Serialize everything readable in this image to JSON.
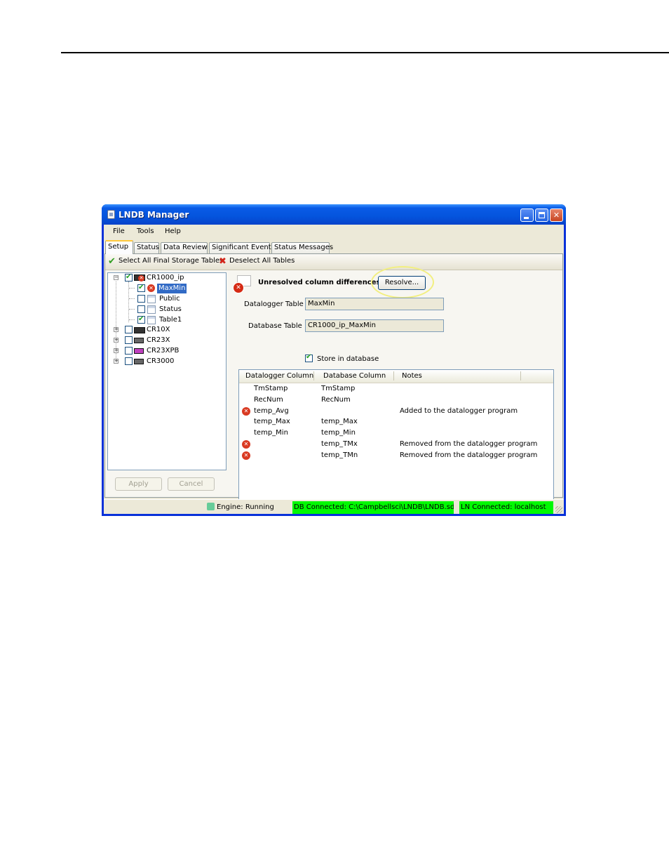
{
  "window": {
    "title": "LNDB Manager"
  },
  "menu": [
    "File",
    "Tools",
    "Help"
  ],
  "tabs": [
    "Setup",
    "Status",
    "Data Review",
    "Significant Events",
    "Status Messages"
  ],
  "toolbar": {
    "select_all": "Select All Final Storage Tables",
    "deselect_all": "Deselect All Tables"
  },
  "tree": {
    "root": "CR1000_ip",
    "tables": [
      "MaxMin",
      "Public",
      "Status",
      "Table1"
    ],
    "others": [
      "CR10X",
      "CR23X",
      "CR23XPB",
      "CR3000"
    ]
  },
  "buttons": {
    "apply": "Apply",
    "cancel": "Cancel",
    "resolve": "Resolve..."
  },
  "detail": {
    "warning": "Unresolved column differences",
    "datalogger_table_label": "Datalogger Table",
    "datalogger_table_value": "MaxMin",
    "database_table_label": "Database Table",
    "database_table_value": "CR1000_ip_MaxMin",
    "store_label": "Store in database"
  },
  "columns": {
    "headers": [
      "Datalogger Column",
      "Database Column",
      "Notes"
    ],
    "rows": [
      {
        "datalogger": "TmStamp",
        "database": "TmStamp",
        "notes": "",
        "error": false
      },
      {
        "datalogger": "RecNum",
        "database": "RecNum",
        "notes": "",
        "error": false
      },
      {
        "datalogger": "temp_Avg",
        "database": "",
        "notes": "Added to the datalogger program",
        "error": true
      },
      {
        "datalogger": "temp_Max",
        "database": "temp_Max",
        "notes": "",
        "error": false
      },
      {
        "datalogger": "temp_Min",
        "database": "temp_Min",
        "notes": "",
        "error": false
      },
      {
        "datalogger": "",
        "database": "temp_TMx",
        "notes": "Removed from the datalogger program",
        "error": true
      },
      {
        "datalogger": "",
        "database": "temp_TMn",
        "notes": "Removed from the datalogger program",
        "error": true
      }
    ]
  },
  "statusbar": {
    "engine": "Engine: Running",
    "db": "DB Connected: C:\\Campbellsci\\LNDB\\LNDB.sdf",
    "ln": "LN Connected: localhost"
  },
  "colors": {
    "title_bar": "#0454dd",
    "status_ok": "#00f800",
    "error": "#d93a22",
    "highlight_ring": "#f2ef80"
  }
}
